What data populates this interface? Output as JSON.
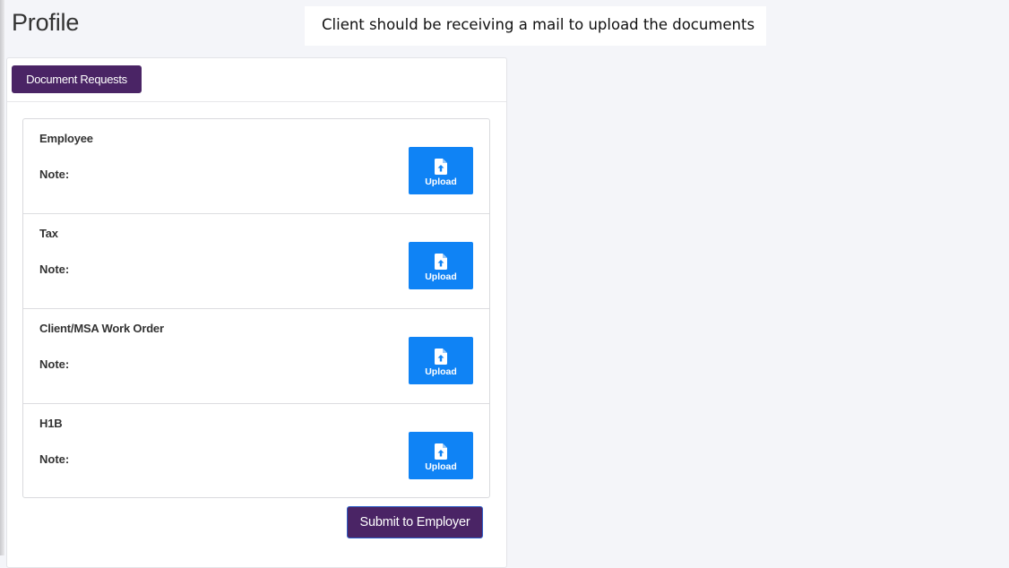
{
  "page": {
    "title": "Profile"
  },
  "annotation": {
    "text": "Client should be receiving a mail to upload the documents"
  },
  "tabs": [
    {
      "label": "Document Requests",
      "active": true
    }
  ],
  "documents": [
    {
      "name": "Employee",
      "note_label": "Note:",
      "note": "",
      "upload_label": "Upload",
      "icon": "file-upload-icon"
    },
    {
      "name": "Tax",
      "note_label": "Note:",
      "note": "",
      "upload_label": "Upload",
      "icon": "file-upload-icon"
    },
    {
      "name": "Client/MSA Work Order",
      "note_label": "Note:",
      "note": "",
      "upload_label": "Upload",
      "icon": "file-upload-icon"
    },
    {
      "name": "H1B",
      "note_label": "Note:",
      "note": "",
      "upload_label": "Upload",
      "icon": "file-upload-icon"
    }
  ],
  "actions": {
    "submit_label": "Submit to Employer"
  },
  "colors": {
    "primary": "#4a2465",
    "upload": "#0f83f5",
    "background": "#f4f5f9"
  }
}
